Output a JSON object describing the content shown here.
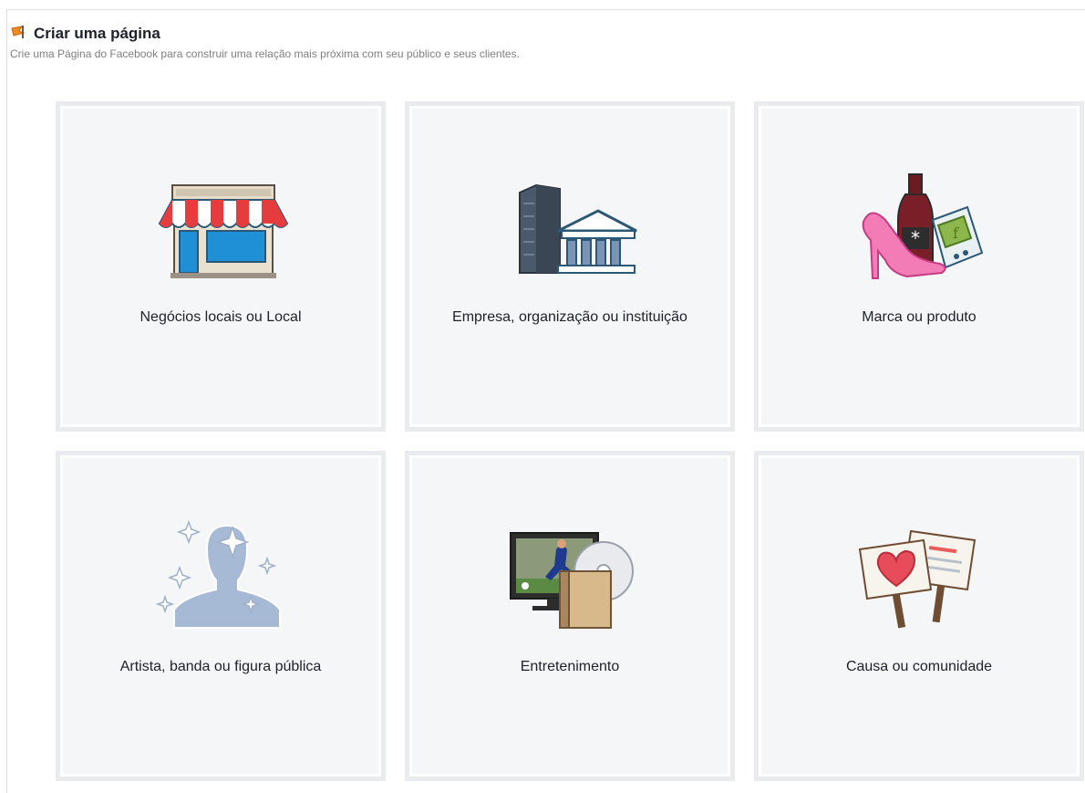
{
  "header": {
    "title": "Criar uma página",
    "subtitle": "Crie uma Página do Facebook para construir uma relação mais próxima com seu público e seus clientes.",
    "icon": "flag-icon"
  },
  "categories": [
    {
      "label": "Negócios locais ou Local",
      "icon": "storefront-icon"
    },
    {
      "label": "Empresa, organização ou instituição",
      "icon": "company-building-icon"
    },
    {
      "label": "Marca ou produto",
      "icon": "brand-product-icon"
    },
    {
      "label": "Artista, banda ou figura pública",
      "icon": "public-figure-icon"
    },
    {
      "label": "Entretenimento",
      "icon": "entertainment-icon"
    },
    {
      "label": "Causa ou comunidade",
      "icon": "cause-signs-icon"
    }
  ],
  "colors": {
    "tile_bg": "#f5f6f7",
    "tile_border": "#e9ebee",
    "flag": "#f28b20"
  }
}
